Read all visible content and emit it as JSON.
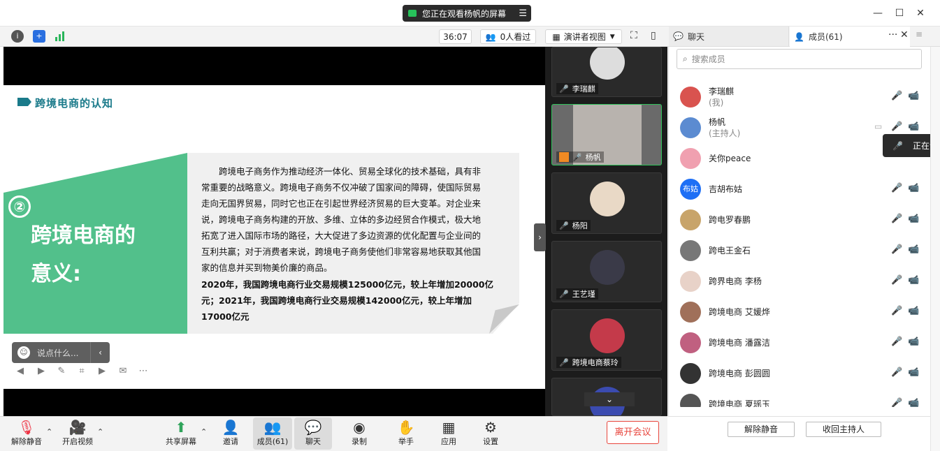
{
  "titlebar": {
    "watching_text": "您正在观看杨帆的屏幕",
    "menu_icon": "list-icon"
  },
  "toolbar": {
    "timer": "36:07",
    "viewers": "0人看过",
    "view_mode": "演讲者视图"
  },
  "right_tabs": {
    "chat": "聊天",
    "members": "成员(61)"
  },
  "slide": {
    "title": "跨境电商的认知",
    "number": "②",
    "heading_line1": "跨境电商的",
    "heading_line2": "意义:",
    "body": "跨境电子商务作为推动经济一体化、贸易全球化的技术基础，具有非常重要的战略意义。跨境电子商务不仅冲破了国家间的障碍，使国际贸易走向无国界贸易，同时它也正在引起世界经济贸易的巨大变革。对企业来说，跨境电子商务构建的开放、多维、立体的多边经贸合作模式，极大地拓宽了进入国际市场的路径，大大促进了多边资源的优化配置与企业间的互利共赢；对于消费者来说，跨境电子商务使他们非常容易地获取其他国家的信息并买到物美价廉的商品。",
    "bold": "2020年，我国跨境电商行业交易规模125000亿元，较上年增加20000亿元；2021年，我国跨境电商行业交易规模142000亿元，较上年增加17000亿元"
  },
  "chat_input": {
    "placeholder": "说点什么..."
  },
  "video_tiles": [
    {
      "name": "李瑞麒"
    },
    {
      "name": "杨帆"
    },
    {
      "name": "杨阳"
    },
    {
      "name": "王艺瑾"
    },
    {
      "name": "跨境电商蔡玲"
    }
  ],
  "bottom": {
    "unmute": "解除静音",
    "video": "开启视频",
    "share": "共享屏幕",
    "invite": "邀请",
    "members": "成员(61)",
    "chat": "聊天",
    "record": "录制",
    "raise_hand": "举手",
    "apps": "应用",
    "settings": "设置",
    "leave": "离开会议"
  },
  "member_panel": {
    "search_placeholder": "搜索成员",
    "members": [
      {
        "name": "李瑞麒",
        "sub": "(我)",
        "color": "#d9534f"
      },
      {
        "name": "杨帆",
        "sub": "(主持人)",
        "color": "#5b8bd1"
      },
      {
        "name": "关你peace",
        "sub": "",
        "color": "#f0a0b0"
      },
      {
        "name": "吉胡布姑",
        "sub": "",
        "avatar_text": "布姑",
        "color": "#1e6ff5"
      },
      {
        "name": "跨电罗春鹏",
        "sub": "",
        "color": "#c8a46a"
      },
      {
        "name": "跨电王金石",
        "sub": "",
        "color": "#777777"
      },
      {
        "name": "跨界电商 李杨",
        "sub": "",
        "color": "#e8d2c8"
      },
      {
        "name": "跨境电商 艾媛烨",
        "sub": "",
        "color": "#a0705a"
      },
      {
        "name": "跨境电商 潘露洁",
        "sub": "",
        "color": "#c06080"
      },
      {
        "name": "跨境电商 彭圆圆",
        "sub": "",
        "color": "#333333"
      },
      {
        "name": "跨境电商 夏瑶玉",
        "sub": "",
        "color": "#555555"
      }
    ],
    "tooltip": "正在讲",
    "unmute_all": "解除静音",
    "reclaim_host": "收回主持人"
  }
}
